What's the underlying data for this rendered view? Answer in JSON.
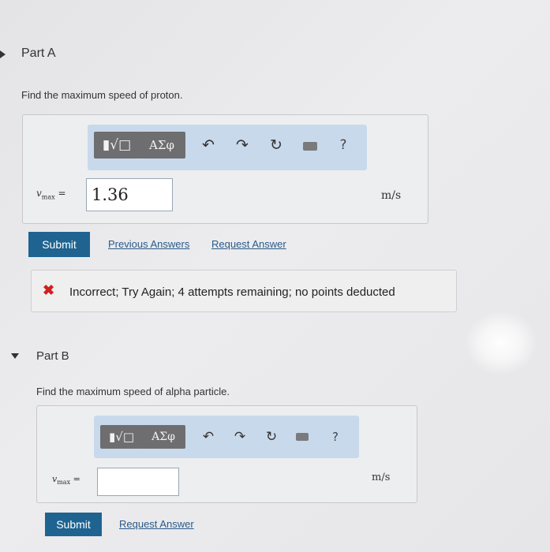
{
  "part_a": {
    "title": "Part A",
    "prompt": "Find the maximum speed of proton.",
    "toolbar": {
      "templates_label": "▮√□",
      "greek_label": "ΑΣφ",
      "help": "?"
    },
    "variable_symbol": "v",
    "variable_subscript": "max",
    "equals": "=",
    "input_value": "1.36",
    "unit": "m/s",
    "submit_label": "Submit",
    "previous_answers_label": "Previous Answers",
    "request_answer_label": "Request Answer",
    "feedback": {
      "icon": "✖",
      "text": "Incorrect; Try Again; 4 attempts remaining; no points deducted"
    }
  },
  "part_b": {
    "title": "Part B",
    "prompt": "Find the maximum speed of alpha particle.",
    "toolbar": {
      "templates_label": "▮√□",
      "greek_label": "ΑΣφ",
      "help": "?"
    },
    "variable_symbol": "v",
    "variable_subscript": "max",
    "equals": "=",
    "input_value": "",
    "unit": "m/s",
    "submit_label": "Submit",
    "request_answer_label": "Request Answer"
  },
  "icons": {
    "undo": "↶",
    "redo": "↷",
    "reset": "↻"
  }
}
